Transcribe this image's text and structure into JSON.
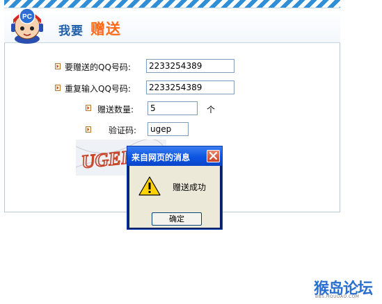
{
  "header": {
    "title_part1": "我要",
    "title_part2": "赠送",
    "mascot_text": "PC"
  },
  "form": {
    "qq_label": "要赠送的QQ号码:",
    "qq_value": "2233254389",
    "repeat_label": "重复输入QQ号码:",
    "repeat_value": "2233254389",
    "count_label": "赠送数量:",
    "count_value": "5",
    "count_unit": "个",
    "captcha_label": "验证码:",
    "captcha_value": "ugep",
    "captcha_image_text": "UGEP"
  },
  "dialog": {
    "title": "来自网页的消息",
    "message": "赠送成功",
    "ok_label": "确定",
    "icon": "warning-icon"
  },
  "watermark": {
    "text": "猴岛论坛",
    "url": "BBS.HOUDAO.COM"
  },
  "colors": {
    "accent": "#ff6a1a",
    "title_blue": "#1f5ea8",
    "dialog_blue": "#0c55e2"
  }
}
